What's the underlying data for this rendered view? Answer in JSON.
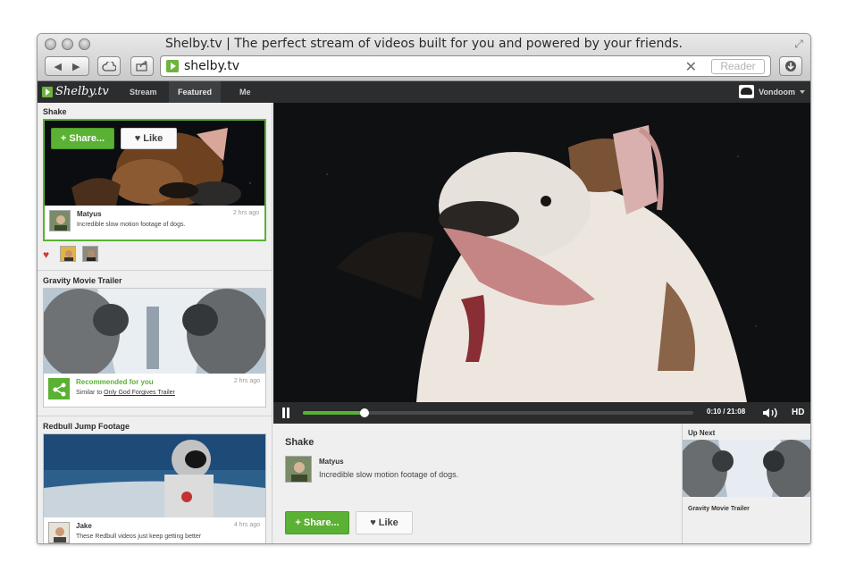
{
  "browser": {
    "title": "Shelby.tv | The perfect stream of videos built for you and powered by your friends.",
    "url": "shelby.tv",
    "reader_label": "Reader",
    "back_icon": "chevron-left-icon",
    "forward_icon": "chevron-right-icon"
  },
  "app": {
    "logo": "Shelby.tv",
    "nav": [
      "Stream",
      "Featured",
      "Me"
    ],
    "active_nav": "Featured",
    "user": "Vondoom",
    "accent_color": "#5ab133"
  },
  "feed": [
    {
      "section": "Shake",
      "share_label": "Share...",
      "like_label": "Like",
      "author": "Matyus",
      "description": "Incredible slow motion footage of dogs.",
      "time": "2 hrs ago"
    },
    {
      "section": "Gravity Movie Trailer",
      "author": "Recommended for you",
      "description_prefix": "Similar to",
      "description_link": "Only God Forgives Trailer",
      "time": "2 hrs ago"
    },
    {
      "section": "Redbull Jump Footage",
      "author": "Jake",
      "description": "These Redbull videos just keep getting better",
      "time": "4 hrs ago"
    }
  ],
  "player": {
    "time": "0:10 / 21:08",
    "progress": 0.157,
    "hd_label": "HD"
  },
  "now_playing": {
    "title": "Shake",
    "author": "Matyus",
    "description": "Incredible slow motion footage of dogs.",
    "share_label": "Share...",
    "like_label": "Like"
  },
  "up_next": {
    "label": "Up Next",
    "title": "Gravity Movie Trailer"
  }
}
